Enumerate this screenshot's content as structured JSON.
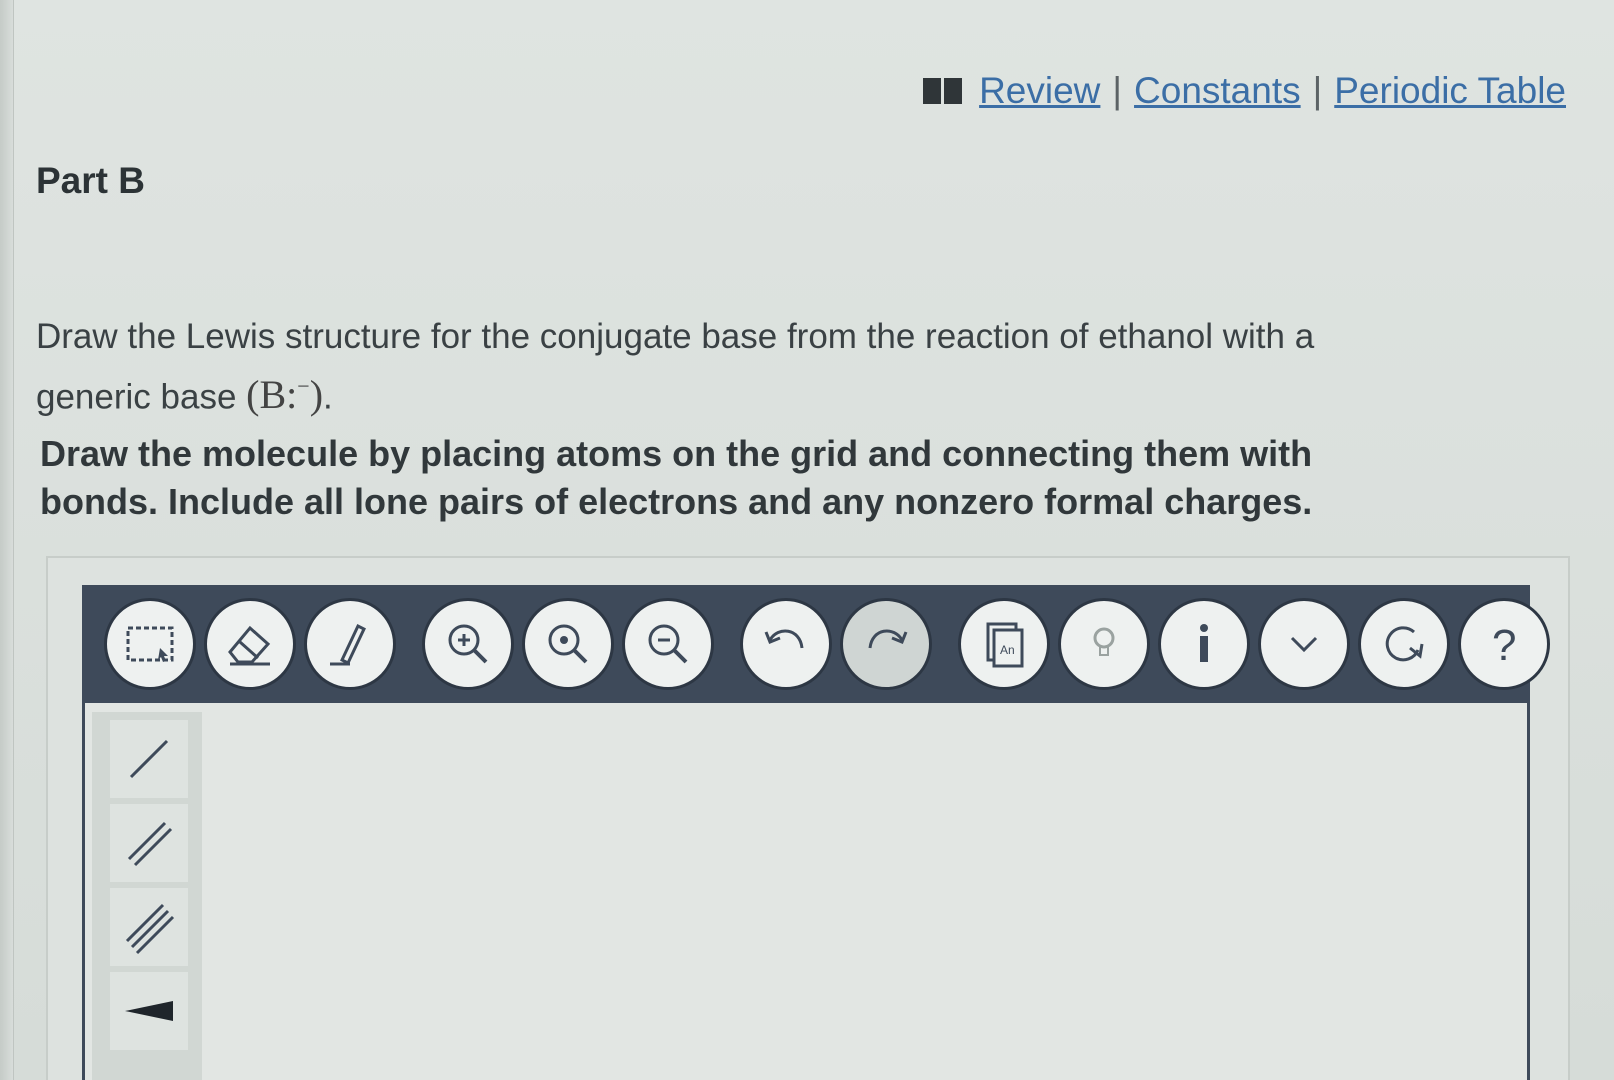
{
  "header": {
    "links": [
      {
        "label": "Review"
      },
      {
        "label": "Constants"
      },
      {
        "label": "Periodic Table"
      }
    ],
    "separator": "|"
  },
  "part": {
    "title": "Part B"
  },
  "question": {
    "line1": "Draw the Lewis structure for the conjugate base from the reaction of ethanol with a",
    "line2_prefix": "generic base ",
    "formula_open": "(",
    "formula_body": "B:",
    "formula_charge": "−",
    "formula_close": ")",
    "line2_suffix": "."
  },
  "instructions": {
    "text": "Draw the molecule by placing atoms on the grid and connecting them with bonds. Include all lone pairs of electrons and any nonzero formal charges."
  },
  "toolbar": {
    "buttons": [
      {
        "icon": "marquee-select-icon"
      },
      {
        "icon": "eraser-icon"
      },
      {
        "icon": "pencil-icon"
      },
      {
        "icon": "zoom-in-icon"
      },
      {
        "icon": "zoom-fit-icon"
      },
      {
        "icon": "zoom-out-icon"
      },
      {
        "icon": "undo-icon"
      },
      {
        "icon": "redo-icon"
      },
      {
        "icon": "templates-icon"
      },
      {
        "icon": "hint-bulb-icon"
      },
      {
        "icon": "info-icon"
      },
      {
        "icon": "chevron-down-icon"
      },
      {
        "icon": "reset-icon"
      },
      {
        "icon": "help-icon"
      }
    ],
    "templates_icon_text": "An",
    "help_glyph": "?"
  },
  "bond_palette": {
    "items": [
      {
        "icon": "single-bond-icon"
      },
      {
        "icon": "double-bond-icon"
      },
      {
        "icon": "triple-bond-icon"
      },
      {
        "icon": "wedge-bond-icon"
      }
    ]
  },
  "colors": {
    "toolbar_bg": "#3e4a5a",
    "link": "#3b6ea6",
    "page_bg": "#dfe4e1"
  }
}
